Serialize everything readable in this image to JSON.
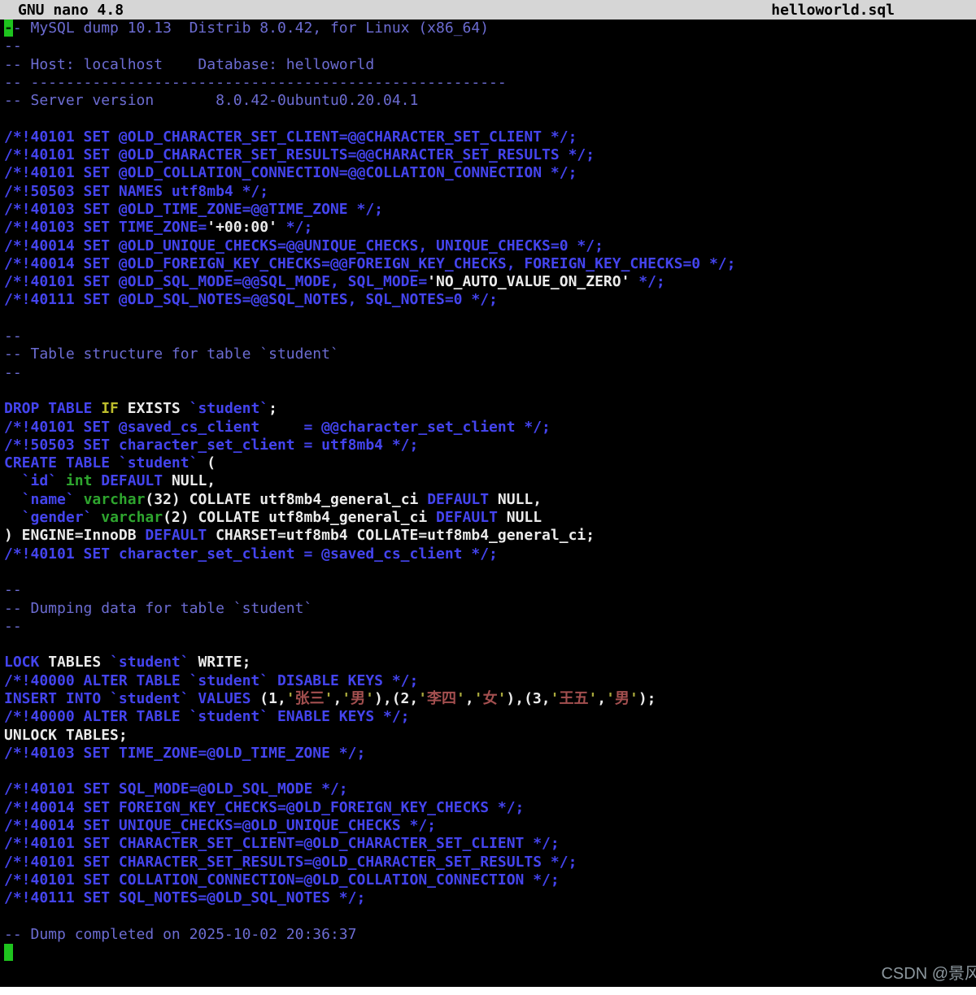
{
  "titlebar": {
    "app": "GNU nano 4.8",
    "filename": "helloworld.sql"
  },
  "watermark": "CSDN @景风",
  "palette": {
    "background": "#000000",
    "titlebar_bg": "#d6d6d6",
    "titlebar_text": "#000000",
    "comment": "#6c6cd2",
    "keyword": "#4444ee",
    "type": "#2ea52e",
    "plain": "#ebebeb",
    "yellow": "#bdbd2c",
    "string": "#a34f4f",
    "quote": "#a9a93c",
    "cursor": "#1ec41e",
    "watermark": "#a5b2ba"
  },
  "editor": {
    "lines": [
      [
        [
          "-",
          "cur"
        ],
        [
          "- MySQL dump 10.13  Distrib 8.0.42, for Linux (x86_64)",
          "com"
        ]
      ],
      [
        [
          "--",
          "com"
        ]
      ],
      [
        [
          "-- Host: localhost    Database: helloworld",
          "com"
        ]
      ],
      [
        [
          "-- ------------------------------------------------------",
          "com"
        ]
      ],
      [
        [
          "-- Server version       8.0.42-0ubuntu0.20.04.1",
          "com"
        ]
      ],
      [],
      [
        [
          "/*!40101 SET @OLD_CHARACTER_SET_CLIENT=@@CHARACTER_SET_CLIENT */;",
          "kw"
        ]
      ],
      [
        [
          "/*!40101 SET @OLD_CHARACTER_SET_RESULTS=@@CHARACTER_SET_RESULTS */;",
          "kw"
        ]
      ],
      [
        [
          "/*!40101 SET @OLD_COLLATION_CONNECTION=@@COLLATION_CONNECTION */;",
          "kw"
        ]
      ],
      [
        [
          "/*!50503 SET NAMES utf8mb4 */;",
          "kw"
        ]
      ],
      [
        [
          "/*!40103 SET @OLD_TIME_ZONE=@@TIME_ZONE */;",
          "kw"
        ]
      ],
      [
        [
          "/*!40103 SET TIME_ZONE=",
          "kw"
        ],
        [
          "'+00:00'",
          "pl"
        ],
        [
          " */;",
          "kw"
        ]
      ],
      [
        [
          "/*!40014 SET @OLD_UNIQUE_CHECKS=@@UNIQUE_CHECKS, UNIQUE_CHECKS=0 */;",
          "kw"
        ]
      ],
      [
        [
          "/*!40014 SET @OLD_FOREIGN_KEY_CHECKS=@@FOREIGN_KEY_CHECKS, FOREIGN_KEY_CHECKS=0 */;",
          "kw"
        ]
      ],
      [
        [
          "/*!40101 SET @OLD_SQL_MODE=@@SQL_MODE, SQL_MODE=",
          "kw"
        ],
        [
          "'NO_AUTO_VALUE_ON_ZERO'",
          "pl"
        ],
        [
          " */;",
          "kw"
        ]
      ],
      [
        [
          "/*!40111 SET @OLD_SQL_NOTES=@@SQL_NOTES, SQL_NOTES=0 */;",
          "kw"
        ]
      ],
      [],
      [
        [
          "--",
          "com"
        ]
      ],
      [
        [
          "-- Table structure for table `student`",
          "com"
        ]
      ],
      [
        [
          "--",
          "com"
        ]
      ],
      [],
      [
        [
          "DROP TABLE ",
          "kw"
        ],
        [
          "IF",
          "yl"
        ],
        [
          " ",
          "pl"
        ],
        [
          "EXISTS ",
          "pl"
        ],
        [
          "`student`",
          "kw"
        ],
        [
          ";",
          "pl"
        ]
      ],
      [
        [
          "/*!40101 SET @saved_cs_client     = @@character_set_client */;",
          "kw"
        ]
      ],
      [
        [
          "/*!50503 SET character_set_client = utf8mb4 */;",
          "kw"
        ]
      ],
      [
        [
          "CREATE TABLE `student`",
          "kw"
        ],
        [
          " (",
          "pl"
        ]
      ],
      [
        [
          "  ",
          "pl"
        ],
        [
          "`id`",
          "kw"
        ],
        [
          " ",
          "pl"
        ],
        [
          "int",
          "ty"
        ],
        [
          " ",
          "pl"
        ],
        [
          "DEFAULT",
          "kw"
        ],
        [
          " NULL,",
          "pl"
        ]
      ],
      [
        [
          "  ",
          "pl"
        ],
        [
          "`name`",
          "kw"
        ],
        [
          " ",
          "pl"
        ],
        [
          "varchar",
          "ty"
        ],
        [
          "(32) COLLATE utf8mb4_general_ci ",
          "pl"
        ],
        [
          "DEFAULT",
          "kw"
        ],
        [
          " NULL,",
          "pl"
        ]
      ],
      [
        [
          "  ",
          "pl"
        ],
        [
          "`gender`",
          "kw"
        ],
        [
          " ",
          "pl"
        ],
        [
          "varchar",
          "ty"
        ],
        [
          "(2) COLLATE utf8mb4_general_ci ",
          "pl"
        ],
        [
          "DEFAULT",
          "kw"
        ],
        [
          " NULL",
          "pl"
        ]
      ],
      [
        [
          ") ENGINE=InnoDB ",
          "pl"
        ],
        [
          "DEFAULT",
          "kw"
        ],
        [
          " CHARSET=utf8mb4 COLLATE=utf8mb4_general_ci;",
          "pl"
        ]
      ],
      [
        [
          "/*!40101 SET character_set_client = @saved_cs_client */;",
          "kw"
        ]
      ],
      [],
      [
        [
          "--",
          "com"
        ]
      ],
      [
        [
          "-- Dumping data for table `student`",
          "com"
        ]
      ],
      [
        [
          "--",
          "com"
        ]
      ],
      [],
      [
        [
          "LOCK",
          "kw"
        ],
        [
          " TABLES ",
          "pl"
        ],
        [
          "`student`",
          "kw"
        ],
        [
          " WRITE;",
          "pl"
        ]
      ],
      [
        [
          "/*!40000 ALTER TABLE `student` DISABLE KEYS */;",
          "kw"
        ]
      ],
      [
        [
          "INSERT INTO `student` VALUES ",
          "kw"
        ],
        [
          "(1,",
          "pl"
        ],
        [
          "'",
          "qt"
        ],
        [
          "张三",
          "st"
        ],
        [
          "'",
          "qt"
        ],
        [
          ",",
          "pl"
        ],
        [
          "'",
          "qt"
        ],
        [
          "男",
          "st"
        ],
        [
          "'",
          "qt"
        ],
        [
          "),(2,",
          "pl"
        ],
        [
          "'",
          "qt"
        ],
        [
          "李四",
          "st"
        ],
        [
          "'",
          "qt"
        ],
        [
          ",",
          "pl"
        ],
        [
          "'",
          "qt"
        ],
        [
          "女",
          "st"
        ],
        [
          "'",
          "qt"
        ],
        [
          "),(3,",
          "pl"
        ],
        [
          "'",
          "qt"
        ],
        [
          "王五",
          "st"
        ],
        [
          "'",
          "qt"
        ],
        [
          ",",
          "pl"
        ],
        [
          "'",
          "qt"
        ],
        [
          "男",
          "st"
        ],
        [
          "'",
          "qt"
        ],
        [
          ");",
          "pl"
        ]
      ],
      [
        [
          "/*!40000 ALTER TABLE `student` ENABLE KEYS */;",
          "kw"
        ]
      ],
      [
        [
          "UNLOCK TABLES;",
          "pl"
        ]
      ],
      [
        [
          "/*!40103 SET TIME_ZONE=@OLD_TIME_ZONE */;",
          "kw"
        ]
      ],
      [],
      [
        [
          "/*!40101 SET SQL_MODE=@OLD_SQL_MODE */;",
          "kw"
        ]
      ],
      [
        [
          "/*!40014 SET FOREIGN_KEY_CHECKS=@OLD_FOREIGN_KEY_CHECKS */;",
          "kw"
        ]
      ],
      [
        [
          "/*!40014 SET UNIQUE_CHECKS=@OLD_UNIQUE_CHECKS */;",
          "kw"
        ]
      ],
      [
        [
          "/*!40101 SET CHARACTER_SET_CLIENT=@OLD_CHARACTER_SET_CLIENT */;",
          "kw"
        ]
      ],
      [
        [
          "/*!40101 SET CHARACTER_SET_RESULTS=@OLD_CHARACTER_SET_RESULTS */;",
          "kw"
        ]
      ],
      [
        [
          "/*!40101 SET COLLATION_CONNECTION=@OLD_COLLATION_CONNECTION */;",
          "kw"
        ]
      ],
      [
        [
          "/*!40111 SET SQL_NOTES=@OLD_SQL_NOTES */;",
          "kw"
        ]
      ],
      [],
      [
        [
          "-- Dump completed on 2025-10-02 20:36:37",
          "com"
        ]
      ],
      [
        [
          " ",
          "cur"
        ]
      ]
    ]
  }
}
